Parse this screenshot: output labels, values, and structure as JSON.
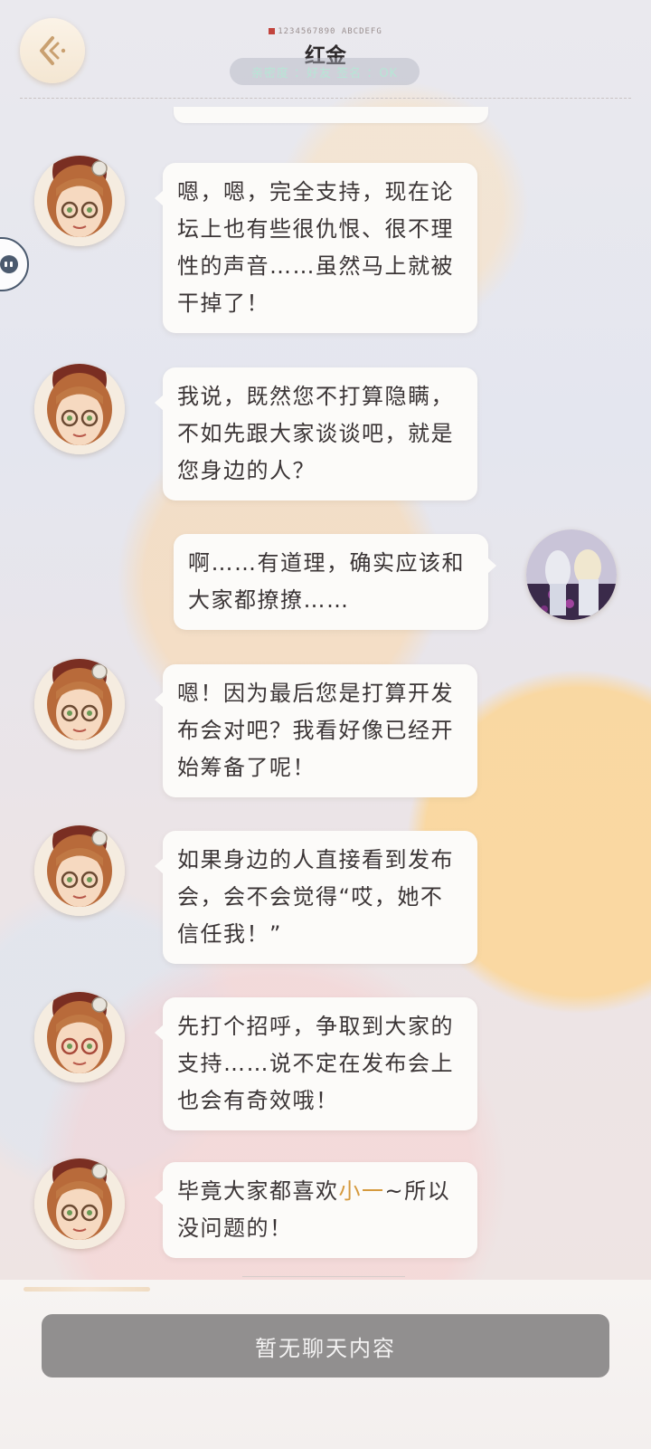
{
  "header": {
    "title": "红金",
    "title_deco": "1234567890 ABCDEFG",
    "status": "亲密度 ：好友 签名 ：OK"
  },
  "messages": [
    {
      "side": "left",
      "text": "嗯，嗯，完全支持，现在论坛上也有些很仇恨、很不理性的声音……虽然马上就被干掉了！"
    },
    {
      "side": "left",
      "text": "我说，既然您不打算隐瞒，不如先跟大家谈谈吧，就是您身边的人？"
    },
    {
      "side": "right",
      "text": "啊……有道理，确实应该和大家都撩撩……"
    },
    {
      "side": "left",
      "text": "嗯！因为最后您是打算开发布会对吧？我看好像已经开始筹备了呢！"
    },
    {
      "side": "left",
      "text": "如果身边的人直接看到发布会，会不会觉得“哎，她不信任我！”"
    },
    {
      "side": "left",
      "text": "先打个招呼，争取到大家的支持……说不定在发布会上也会有奇效哦！"
    },
    {
      "side": "left",
      "text_before": "毕竟大家都喜欢",
      "text_highlight": "小一",
      "text_after": "~所以没问题的！"
    }
  ],
  "footer": {
    "empty_chat_label": "暂无聊天内容"
  },
  "colors": {
    "accent_highlight": "#d59a3e",
    "bubble_bg": "#fcfbf9",
    "input_bar_bg": "#918f8f"
  },
  "icons": {
    "back": "back-arrow-icon",
    "side_handle": "float-menu-icon",
    "contact_avatar": "girl-with-glasses-avatar",
    "player_avatar": "player-avatar"
  }
}
